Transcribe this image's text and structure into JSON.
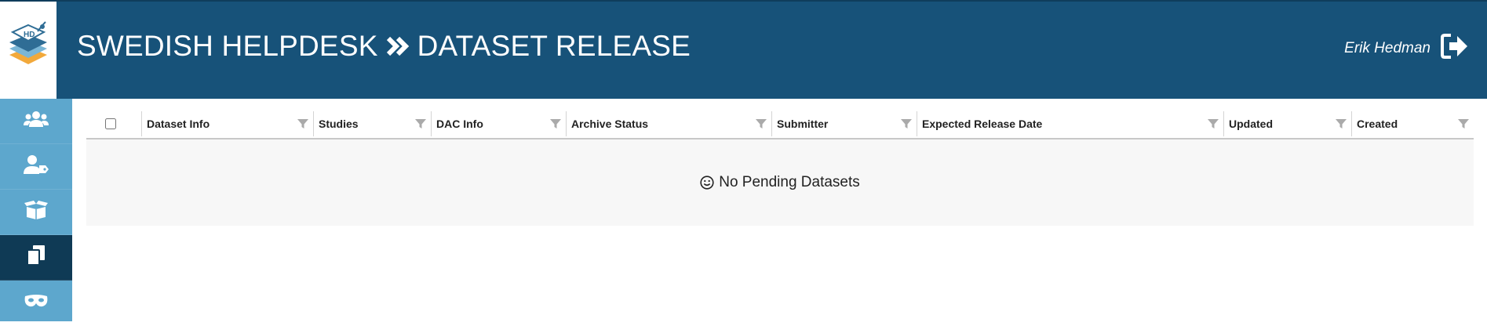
{
  "header": {
    "app_name": "SWEDISH HELPDESK",
    "page_name": "DATASET RELEASE",
    "separator_icon": "double-chevron-right-icon",
    "logo_text": "HD",
    "colors": {
      "topbar": "#175279",
      "sidebar": "#5da7cd",
      "sidebar_active": "#0f3a55"
    }
  },
  "user": {
    "name": "Erik Hedman",
    "logout_icon": "sign-out-icon"
  },
  "sidebar": {
    "items": [
      {
        "icon": "users-icon",
        "active": false
      },
      {
        "icon": "user-tag-icon",
        "active": false
      },
      {
        "icon": "open-box-icon",
        "active": false
      },
      {
        "icon": "copy-documents-icon",
        "active": true
      },
      {
        "icon": "mask-icon",
        "active": false
      }
    ]
  },
  "table": {
    "columns": [
      {
        "label": "Dataset Info"
      },
      {
        "label": "Studies"
      },
      {
        "label": "DAC Info"
      },
      {
        "label": "Archive Status"
      },
      {
        "label": "Submitter"
      },
      {
        "label": "Expected Release Date"
      },
      {
        "label": "Updated"
      },
      {
        "label": "Created"
      }
    ],
    "filter_icon": "filter-icon",
    "empty_icon": "smiley-icon",
    "empty_message": "No Pending Datasets"
  }
}
